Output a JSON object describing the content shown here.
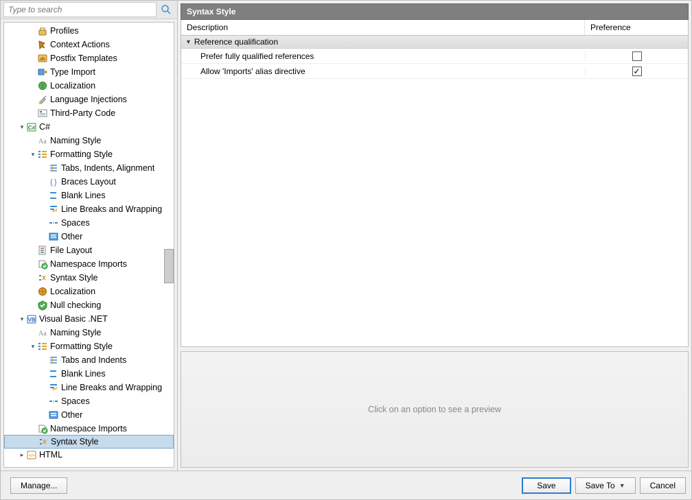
{
  "search": {
    "placeholder": "Type to search"
  },
  "tree": {
    "items": [
      {
        "depth": 2,
        "twisty": null,
        "icon": "profiles",
        "label": "Profiles"
      },
      {
        "depth": 2,
        "twisty": null,
        "icon": "context-actions",
        "label": "Context Actions"
      },
      {
        "depth": 2,
        "twisty": null,
        "icon": "postfix",
        "label": "Postfix Templates"
      },
      {
        "depth": 2,
        "twisty": null,
        "icon": "type-import",
        "label": "Type Import"
      },
      {
        "depth": 2,
        "twisty": null,
        "icon": "localization",
        "label": "Localization"
      },
      {
        "depth": 2,
        "twisty": null,
        "icon": "injections",
        "label": "Language Injections"
      },
      {
        "depth": 2,
        "twisty": null,
        "icon": "thirdparty",
        "label": "Third-Party Code"
      },
      {
        "depth": 1,
        "twisty": "open",
        "icon": "csharp",
        "label": "C#"
      },
      {
        "depth": 2,
        "twisty": null,
        "icon": "naming",
        "label": "Naming Style"
      },
      {
        "depth": 2,
        "twisty": "open",
        "icon": "formatting",
        "label": "Formatting Style"
      },
      {
        "depth": 3,
        "twisty": null,
        "icon": "tabs",
        "label": "Tabs, Indents, Alignment"
      },
      {
        "depth": 3,
        "twisty": null,
        "icon": "braces",
        "label": "Braces Layout"
      },
      {
        "depth": 3,
        "twisty": null,
        "icon": "blanklines",
        "label": "Blank Lines"
      },
      {
        "depth": 3,
        "twisty": null,
        "icon": "linebreaks",
        "label": "Line Breaks and Wrapping"
      },
      {
        "depth": 3,
        "twisty": null,
        "icon": "spaces",
        "label": "Spaces"
      },
      {
        "depth": 3,
        "twisty": null,
        "icon": "other",
        "label": "Other"
      },
      {
        "depth": 2,
        "twisty": null,
        "icon": "filelayout",
        "label": "File Layout"
      },
      {
        "depth": 2,
        "twisty": null,
        "icon": "namespace",
        "label": "Namespace Imports"
      },
      {
        "depth": 2,
        "twisty": null,
        "icon": "syntax",
        "label": "Syntax Style"
      },
      {
        "depth": 2,
        "twisty": null,
        "icon": "localization2",
        "label": "Localization"
      },
      {
        "depth": 2,
        "twisty": null,
        "icon": "nullcheck",
        "label": "Null checking"
      },
      {
        "depth": 1,
        "twisty": "open",
        "icon": "vbnet",
        "label": "Visual Basic .NET"
      },
      {
        "depth": 2,
        "twisty": null,
        "icon": "naming",
        "label": "Naming Style"
      },
      {
        "depth": 2,
        "twisty": "open",
        "icon": "formatting",
        "label": "Formatting Style"
      },
      {
        "depth": 3,
        "twisty": null,
        "icon": "tabs",
        "label": "Tabs and Indents"
      },
      {
        "depth": 3,
        "twisty": null,
        "icon": "blanklines",
        "label": "Blank Lines"
      },
      {
        "depth": 3,
        "twisty": null,
        "icon": "linebreaks",
        "label": "Line Breaks and Wrapping"
      },
      {
        "depth": 3,
        "twisty": null,
        "icon": "spaces",
        "label": "Spaces"
      },
      {
        "depth": 3,
        "twisty": null,
        "icon": "other",
        "label": "Other"
      },
      {
        "depth": 2,
        "twisty": null,
        "icon": "namespace",
        "label": "Namespace Imports"
      },
      {
        "depth": 2,
        "twisty": null,
        "icon": "syntax",
        "label": "Syntax Style",
        "selected": true
      },
      {
        "depth": 1,
        "twisty": "closed",
        "icon": "html",
        "label": "HTML"
      }
    ]
  },
  "panel": {
    "title": "Syntax Style",
    "columns": {
      "desc": "Description",
      "pref": "Preference"
    },
    "group": "Reference qualification",
    "options": [
      {
        "desc": "Prefer fully qualified references",
        "checked": false
      },
      {
        "desc": "Allow 'Imports' alias directive",
        "checked": true
      }
    ],
    "preview_placeholder": "Click on an option to see a preview"
  },
  "footer": {
    "manage": "Manage...",
    "save": "Save",
    "saveto": "Save To",
    "cancel": "Cancel"
  }
}
